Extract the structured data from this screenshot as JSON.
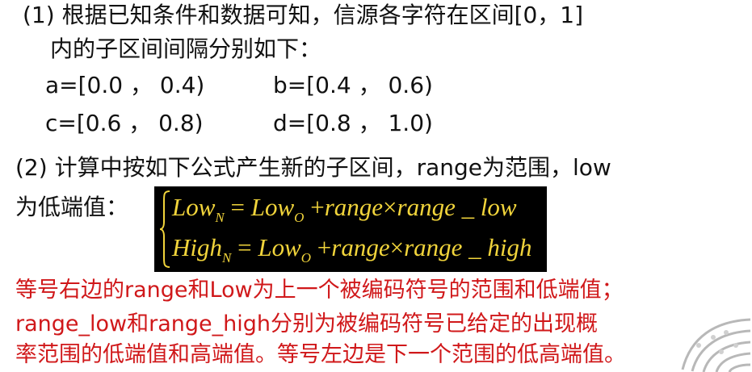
{
  "text": {
    "p1_line1": "(1) 根据已知条件和数据可知，信源各字符在区间[0，1]",
    "p1_line2": "内的子区间间隔分别如下：",
    "int_a": "a=[0.0 ， 0.4)",
    "int_b": "b=[0.4 ， 0.6)",
    "int_c": "c=[0.6 ， 0.8)",
    "int_d": "d=[0.8 ， 1.0)",
    "p2_line1": "(2) 计算中按如下公式产生新的子区间，range为范围，low",
    "p2_line2": "为低端值：",
    "note_line1": "等号右边的range和Low为上一个被编码符号的范围和低端值；",
    "note_line2": "range_low和range_high分别为被编码符号已给定的出现概",
    "note_line3": "率范围的低端值和高端值。等号左边是下一个范围的低高端值。"
  },
  "formula": {
    "row1": {
      "lhs": "Low",
      "lhs_sub": "N",
      "eq": "=",
      "low": "Low",
      "low_sub": "O",
      "plus": "+",
      "range": "range",
      "times": "×",
      "term": "range _ low"
    },
    "row2": {
      "lhs": "High",
      "lhs_sub": "N",
      "eq": "=",
      "low": "Low",
      "low_sub": "O",
      "plus": "+",
      "range": "range",
      "times": "×",
      "term": "range _ high"
    }
  },
  "colors": {
    "body_text": "#111111",
    "note_text": "#d0181a",
    "formula_bg": "#000000",
    "formula_text": "#f1d43b"
  }
}
